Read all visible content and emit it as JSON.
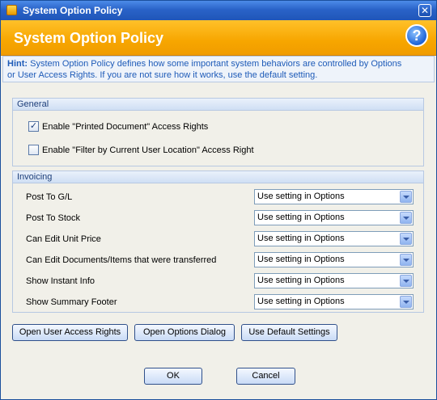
{
  "window": {
    "title": "System Option Policy",
    "close_glyph": "✕"
  },
  "header": {
    "title": "System Option Policy",
    "help_glyph": "?"
  },
  "hint": {
    "label": "Hint:",
    "text_line1": "System Option Policy defines how some important system behaviors are controlled by Options",
    "text_line2": "or User Access Rights. If you are not sure how it works, use the default setting."
  },
  "general": {
    "title": "General",
    "options": [
      {
        "label": "Enable \"Printed Document\" Access Rights",
        "checked": true
      },
      {
        "label": "Enable \"Filter by Current User Location\" Access Right",
        "checked": false
      }
    ]
  },
  "invoicing": {
    "title": "Invoicing",
    "rows": [
      {
        "label": "Post To G/L",
        "value": "Use setting in Options"
      },
      {
        "label": "Post To Stock",
        "value": "Use setting in Options"
      },
      {
        "label": "Can Edit Unit Price",
        "value": "Use setting in Options"
      },
      {
        "label": "Can Edit Documents/Items that were transferred",
        "value": "Use setting in Options"
      },
      {
        "label": "Show Instant Info",
        "value": "Use setting in Options"
      },
      {
        "label": "Show Summary Footer",
        "value": "Use setting in Options"
      }
    ]
  },
  "buttons": {
    "open_user_access_rights": "Open User Access Rights",
    "open_options_dialog": "Open Options Dialog",
    "use_default_settings": "Use Default Settings",
    "ok": "OK",
    "cancel": "Cancel"
  },
  "icons": {
    "checkmark": "✓"
  }
}
